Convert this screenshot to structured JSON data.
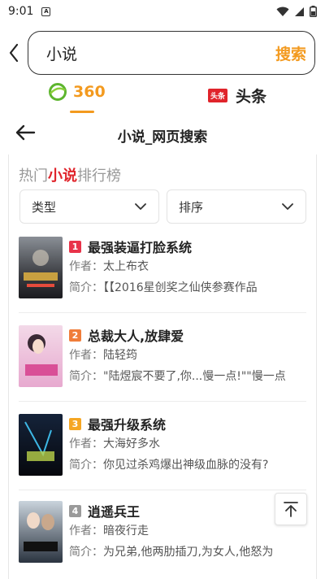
{
  "status_bar": {
    "time": "9:01",
    "sim_label": "A"
  },
  "search": {
    "query": "小说",
    "button_label": "搜索"
  },
  "engine_tabs": [
    {
      "label": "360",
      "active": true,
      "accent": "#f39a1f"
    },
    {
      "label": "头条",
      "badge": "头条",
      "active": false
    }
  ],
  "web_header": {
    "title": "小说_网页搜索"
  },
  "ranking": {
    "title_prefix": "热门",
    "title_highlight": "小说",
    "title_suffix": "排行榜",
    "filters": [
      {
        "label": "类型"
      },
      {
        "label": "排序"
      }
    ],
    "author_label": "作者：",
    "summary_label": "简介：",
    "books": [
      {
        "rank": "1",
        "rank_color": "#e8334a",
        "title": "最强装逼打脸系统",
        "author": "太上布衣",
        "summary": "【【2016星创奖之仙侠参赛作品"
      },
      {
        "rank": "2",
        "rank_color": "#f07d3a",
        "title": "总裁大人,放肆爱",
        "author": "陆轻筠",
        "summary": "\"陆煜宸不要了,你...慢一点!\"\"慢一点"
      },
      {
        "rank": "3",
        "rank_color": "#f5a623",
        "title": "最强升级系统",
        "author": "大海好多水",
        "summary": "你见过杀鸡爆出神级血脉的没有?"
      },
      {
        "rank": "4",
        "rank_color": "#9a9a9a",
        "title": "逍遥兵王",
        "author": "暗夜行走",
        "summary": "为兄弟,他两肋插刀,为女人,他怒为"
      }
    ]
  }
}
